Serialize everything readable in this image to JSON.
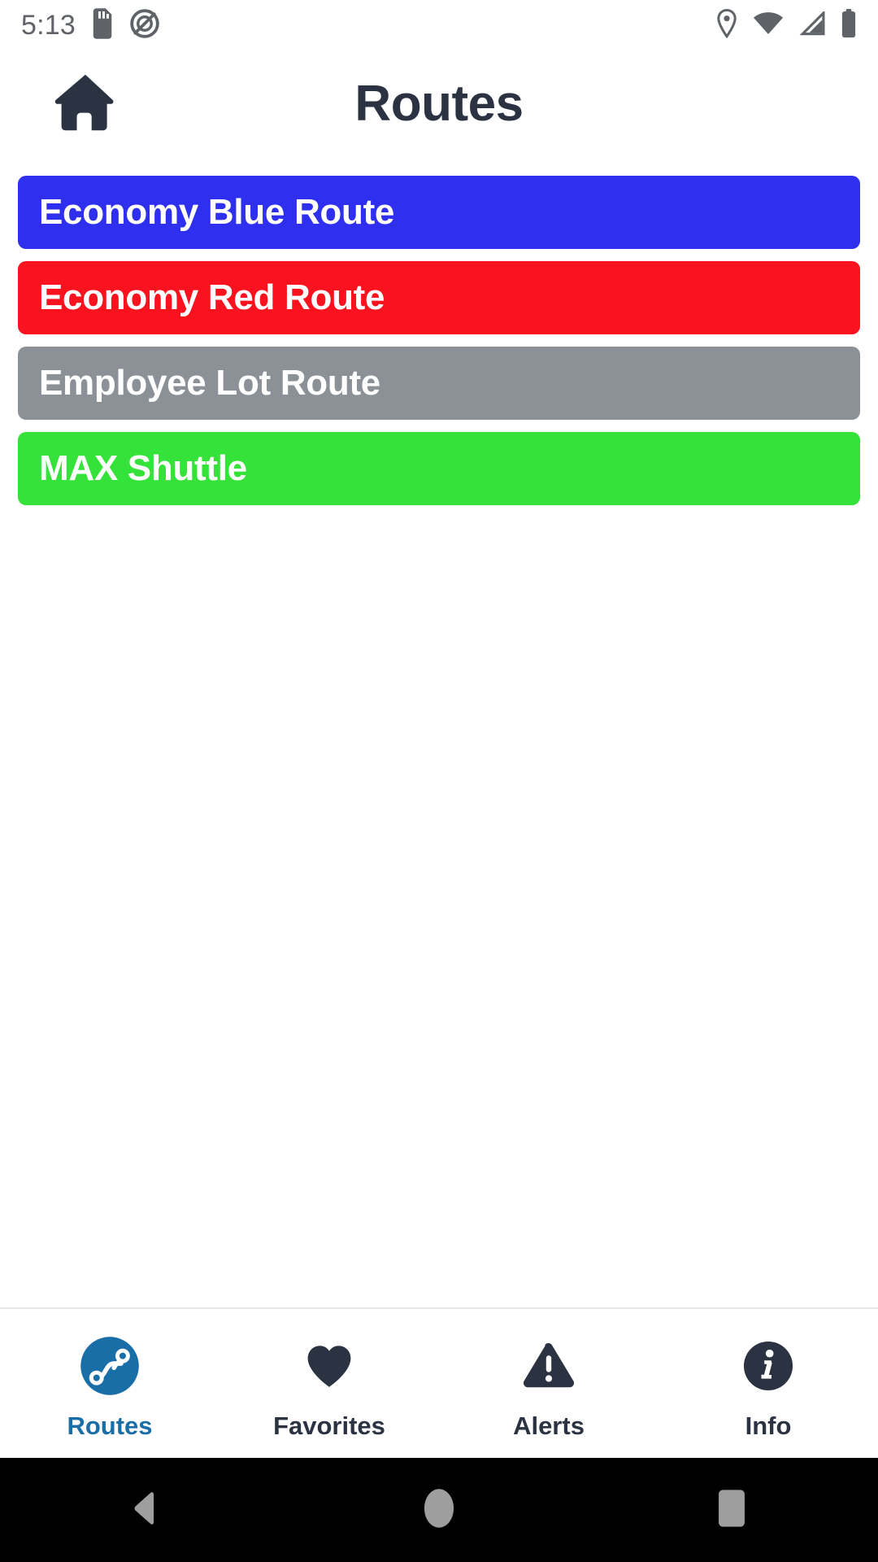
{
  "status_bar": {
    "time": "5:13",
    "left_icons": [
      "sd-card-icon",
      "do-not-disturb-icon"
    ],
    "right_icons": [
      "location-pin-icon",
      "wifi-icon",
      "cellular-signal-icon",
      "battery-icon"
    ],
    "icon_color": "#5f6368"
  },
  "header": {
    "title": "Routes",
    "home_icon": "home-icon",
    "title_color": "#2b3242"
  },
  "routes": {
    "items": [
      {
        "label": "Economy Blue Route",
        "color": "#2f2ff0",
        "text_color": "#ffffff"
      },
      {
        "label": "Economy Red Route",
        "color": "#fb121f",
        "text_color": "#ffffff"
      },
      {
        "label": "Employee Lot Route",
        "color": "#8b9197",
        "text_color": "#ffffff"
      },
      {
        "label": "MAX Shuttle",
        "color": "#35e239",
        "text_color": "#ffffff"
      }
    ]
  },
  "tab_bar": {
    "active_index": 0,
    "active_color": "#1a6ea8",
    "inactive_color": "#2b3242",
    "tabs": [
      {
        "label": "Routes",
        "icon": "route-path-icon"
      },
      {
        "label": "Favorites",
        "icon": "heart-icon"
      },
      {
        "label": "Alerts",
        "icon": "warning-triangle-icon"
      },
      {
        "label": "Info",
        "icon": "info-circle-icon"
      }
    ]
  },
  "android_nav": {
    "buttons": [
      {
        "name": "back-button",
        "icon": "back-triangle-icon"
      },
      {
        "name": "home-button",
        "icon": "home-circle-icon"
      },
      {
        "name": "recents-button",
        "icon": "recents-square-icon"
      }
    ],
    "icon_color": "#9e9e9e",
    "background": "#000000"
  }
}
